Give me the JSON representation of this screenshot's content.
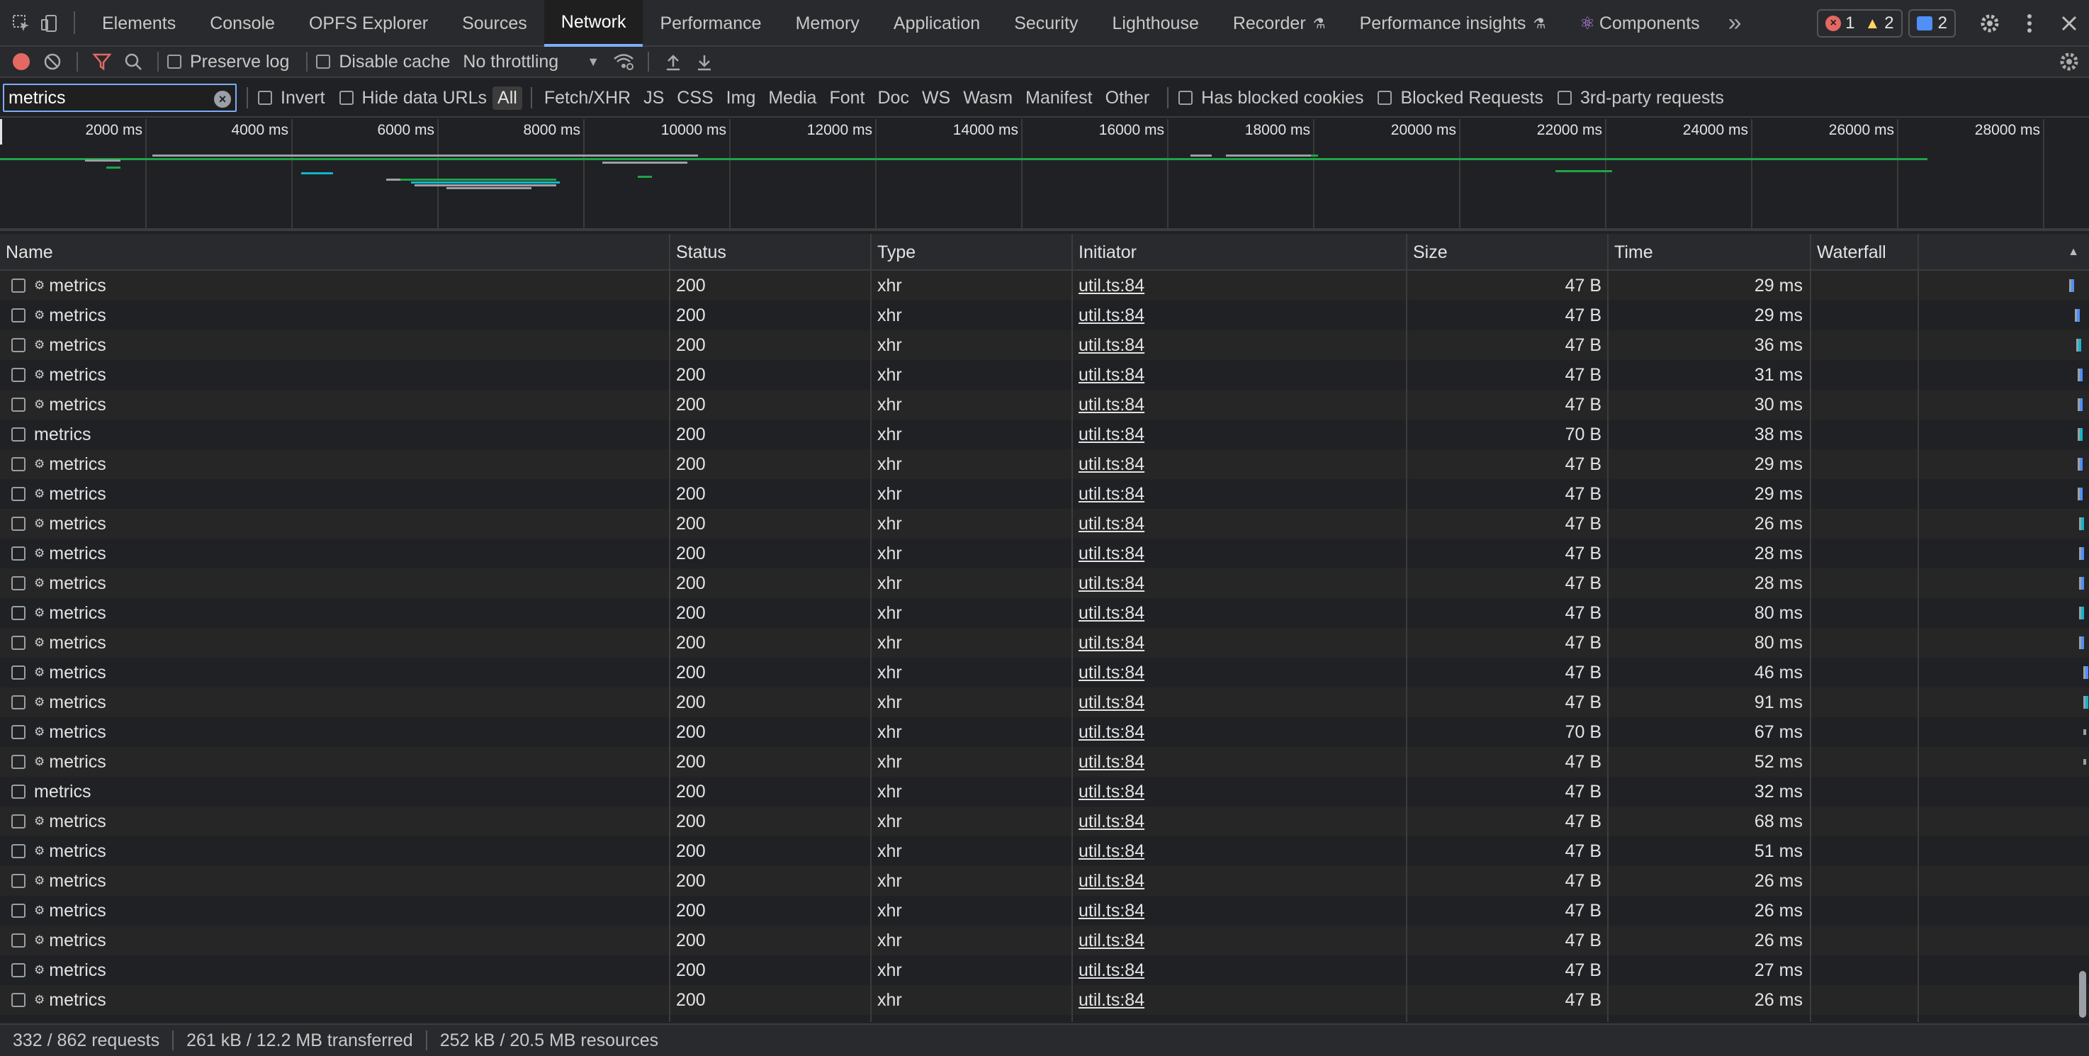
{
  "tabs": [
    {
      "label": "Elements",
      "active": false,
      "icon": ""
    },
    {
      "label": "Console",
      "active": false,
      "icon": ""
    },
    {
      "label": "OPFS Explorer",
      "active": false,
      "icon": ""
    },
    {
      "label": "Sources",
      "active": false,
      "icon": ""
    },
    {
      "label": "Network",
      "active": true,
      "icon": ""
    },
    {
      "label": "Performance",
      "active": false,
      "icon": ""
    },
    {
      "label": "Memory",
      "active": false,
      "icon": ""
    },
    {
      "label": "Application",
      "active": false,
      "icon": ""
    },
    {
      "label": "Security",
      "active": false,
      "icon": ""
    },
    {
      "label": "Lighthouse",
      "active": false,
      "icon": ""
    },
    {
      "label": "Recorder",
      "active": false,
      "icon": "flask-icon"
    },
    {
      "label": "Performance insights",
      "active": false,
      "icon": "flask-icon"
    },
    {
      "label": "Components",
      "active": false,
      "icon": "react-icon"
    }
  ],
  "issues": {
    "errors": "1",
    "warnings": "2",
    "messages": "2"
  },
  "toolbar": {
    "preserve_log": "Preserve log",
    "disable_cache": "Disable cache",
    "throttling": "No throttling"
  },
  "filter": {
    "value": "metrics",
    "invert": "Invert",
    "hide_data_urls": "Hide data URLs",
    "types": [
      "All",
      "Fetch/XHR",
      "JS",
      "CSS",
      "Img",
      "Media",
      "Font",
      "Doc",
      "WS",
      "Wasm",
      "Manifest",
      "Other"
    ],
    "active_type": "All",
    "has_blocked_cookies": "Has blocked cookies",
    "blocked_requests": "Blocked Requests",
    "third_party": "3rd-party requests"
  },
  "overview": {
    "ticks": [
      "2000 ms",
      "4000 ms",
      "6000 ms",
      "8000 ms",
      "10000 ms",
      "12000 ms",
      "14000 ms",
      "16000 ms",
      "18000 ms",
      "20000 ms",
      "22000 ms",
      "24000 ms",
      "26000 ms",
      "28000 ms"
    ],
    "colors": {
      "finished": "#9aa0a6",
      "script": "#1ea446",
      "xhr": "#12b5cb",
      "doc": "#4f8ff7"
    }
  },
  "table": {
    "columns": [
      "Name",
      "Status",
      "Type",
      "Initiator",
      "Size",
      "Time",
      "Waterfall"
    ],
    "sorted_column": "Waterfall",
    "rows": [
      {
        "name": "metrics",
        "gear": true,
        "status": "200",
        "type": "xhr",
        "initiator": "util.ts:84",
        "size": "47 B",
        "time": "29 ms"
      },
      {
        "name": "metrics",
        "gear": true,
        "status": "200",
        "type": "xhr",
        "initiator": "util.ts:84",
        "size": "47 B",
        "time": "29 ms"
      },
      {
        "name": "metrics",
        "gear": true,
        "status": "200",
        "type": "xhr",
        "initiator": "util.ts:84",
        "size": "47 B",
        "time": "36 ms"
      },
      {
        "name": "metrics",
        "gear": true,
        "status": "200",
        "type": "xhr",
        "initiator": "util.ts:84",
        "size": "47 B",
        "time": "31 ms"
      },
      {
        "name": "metrics",
        "gear": true,
        "status": "200",
        "type": "xhr",
        "initiator": "util.ts:84",
        "size": "47 B",
        "time": "30 ms"
      },
      {
        "name": "metrics",
        "gear": false,
        "status": "200",
        "type": "xhr",
        "initiator": "util.ts:84",
        "size": "70 B",
        "time": "38 ms"
      },
      {
        "name": "metrics",
        "gear": true,
        "status": "200",
        "type": "xhr",
        "initiator": "util.ts:84",
        "size": "47 B",
        "time": "29 ms"
      },
      {
        "name": "metrics",
        "gear": true,
        "status": "200",
        "type": "xhr",
        "initiator": "util.ts:84",
        "size": "47 B",
        "time": "29 ms"
      },
      {
        "name": "metrics",
        "gear": true,
        "status": "200",
        "type": "xhr",
        "initiator": "util.ts:84",
        "size": "47 B",
        "time": "26 ms"
      },
      {
        "name": "metrics",
        "gear": true,
        "status": "200",
        "type": "xhr",
        "initiator": "util.ts:84",
        "size": "47 B",
        "time": "28 ms"
      },
      {
        "name": "metrics",
        "gear": true,
        "status": "200",
        "type": "xhr",
        "initiator": "util.ts:84",
        "size": "47 B",
        "time": "28 ms"
      },
      {
        "name": "metrics",
        "gear": true,
        "status": "200",
        "type": "xhr",
        "initiator": "util.ts:84",
        "size": "47 B",
        "time": "80 ms"
      },
      {
        "name": "metrics",
        "gear": true,
        "status": "200",
        "type": "xhr",
        "initiator": "util.ts:84",
        "size": "47 B",
        "time": "80 ms"
      },
      {
        "name": "metrics",
        "gear": true,
        "status": "200",
        "type": "xhr",
        "initiator": "util.ts:84",
        "size": "47 B",
        "time": "46 ms"
      },
      {
        "name": "metrics",
        "gear": true,
        "status": "200",
        "type": "xhr",
        "initiator": "util.ts:84",
        "size": "47 B",
        "time": "91 ms"
      },
      {
        "name": "metrics",
        "gear": true,
        "status": "200",
        "type": "xhr",
        "initiator": "util.ts:84",
        "size": "70 B",
        "time": "67 ms"
      },
      {
        "name": "metrics",
        "gear": true,
        "status": "200",
        "type": "xhr",
        "initiator": "util.ts:84",
        "size": "47 B",
        "time": "52 ms"
      },
      {
        "name": "metrics",
        "gear": false,
        "status": "200",
        "type": "xhr",
        "initiator": "util.ts:84",
        "size": "47 B",
        "time": "32 ms"
      },
      {
        "name": "metrics",
        "gear": true,
        "status": "200",
        "type": "xhr",
        "initiator": "util.ts:84",
        "size": "47 B",
        "time": "68 ms"
      },
      {
        "name": "metrics",
        "gear": true,
        "status": "200",
        "type": "xhr",
        "initiator": "util.ts:84",
        "size": "47 B",
        "time": "51 ms"
      },
      {
        "name": "metrics",
        "gear": true,
        "status": "200",
        "type": "xhr",
        "initiator": "util.ts:84",
        "size": "47 B",
        "time": "26 ms"
      },
      {
        "name": "metrics",
        "gear": true,
        "status": "200",
        "type": "xhr",
        "initiator": "util.ts:84",
        "size": "47 B",
        "time": "26 ms"
      },
      {
        "name": "metrics",
        "gear": true,
        "status": "200",
        "type": "xhr",
        "initiator": "util.ts:84",
        "size": "47 B",
        "time": "26 ms"
      },
      {
        "name": "metrics",
        "gear": true,
        "status": "200",
        "type": "xhr",
        "initiator": "util.ts:84",
        "size": "47 B",
        "time": "27 ms"
      },
      {
        "name": "metrics",
        "gear": true,
        "status": "200",
        "type": "xhr",
        "initiator": "util.ts:84",
        "size": "47 B",
        "time": "26 ms"
      }
    ]
  },
  "status": {
    "requests": "332 / 862 requests",
    "transferred": "261 kB / 12.2 MB transferred",
    "resources": "252 kB / 20.5 MB resources"
  }
}
